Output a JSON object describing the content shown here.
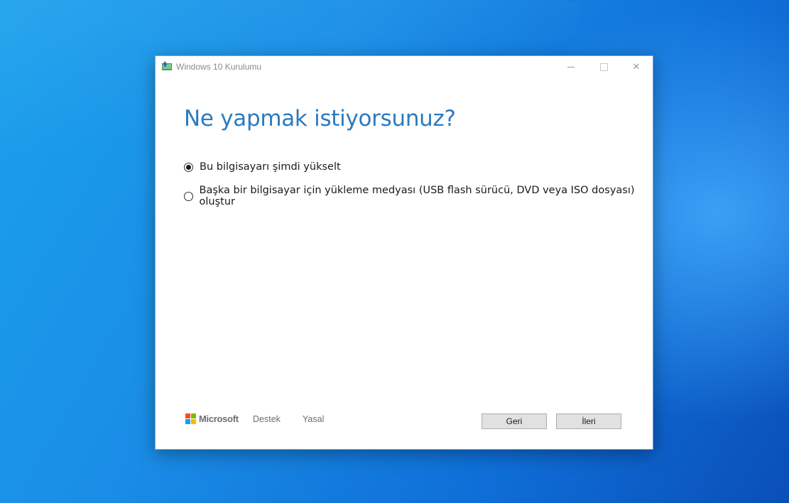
{
  "window": {
    "title": "Windows 10 Kurulumu",
    "controls": {
      "minimize": "minimize",
      "maximize": "maximize",
      "close": "✕"
    }
  },
  "main": {
    "heading": "Ne yapmak istiyorsunuz?",
    "options": [
      {
        "label": "Bu bilgisayarı şimdi yükselt",
        "selected": true
      },
      {
        "label": "Başka bir bilgisayar için yükleme medyası (USB flash sürücü, DVD veya ISO dosyası) oluştur",
        "selected": false
      }
    ]
  },
  "footer": {
    "brand": "Microsoft",
    "links": {
      "support": "Destek",
      "legal": "Yasal"
    },
    "buttons": {
      "back": "Geri",
      "next": "İleri"
    }
  },
  "colors": {
    "heading": "#2b7bbf",
    "desktop": "#1a8ee6"
  }
}
